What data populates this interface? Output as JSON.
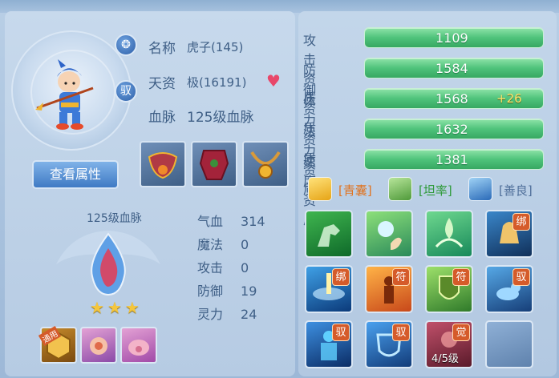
{
  "character": {
    "name_label": "名称",
    "name_value": "虎子(145)",
    "aptitude_label": "天资",
    "aptitude_value": "极(16191)",
    "bloodline_label": "血脉",
    "bloodline_value": "125级血脉",
    "round_button_1": "❂",
    "round_button_2": "驭",
    "view_button": "查看属性"
  },
  "bloodline_panel": {
    "title": "125级血脉",
    "stars": [
      "★",
      "★",
      "★"
    ],
    "small_badge": "通用"
  },
  "stats": [
    {
      "label": "气血",
      "value": "314"
    },
    {
      "label": "魔法",
      "value": "0"
    },
    {
      "label": "攻击",
      "value": "0"
    },
    {
      "label": "防御",
      "value": "19"
    },
    {
      "label": "灵力",
      "value": "24"
    }
  ],
  "aptitudes": [
    {
      "label": "攻击资质",
      "value": "1109",
      "bonus": ""
    },
    {
      "label": "防御资质",
      "value": "1584",
      "bonus": ""
    },
    {
      "label": "体力资质",
      "value": "1568",
      "bonus": "+26"
    },
    {
      "label": "法力资质",
      "value": "1632",
      "bonus": ""
    },
    {
      "label": "速度资质",
      "value": "1381",
      "bonus": ""
    }
  ],
  "traits": [
    {
      "text": "[青囊]",
      "color": "#e0731f"
    },
    {
      "text": "[坦率]",
      "color": "#2e9a3a"
    },
    {
      "text": "[善良]",
      "color": "#4f6f9a"
    }
  ],
  "skill_badges": {
    "b1": "绑",
    "b2": "绑",
    "b3": "符",
    "b4": "符",
    "b5": "驭",
    "b6": "驭",
    "b7": "驭",
    "b8": "觉"
  },
  "skill_level": "4/5级",
  "colors": {
    "accent": "#3f7ac4",
    "bar_green": "#4fc37b",
    "bonus_yellow": "#ffe36a"
  }
}
